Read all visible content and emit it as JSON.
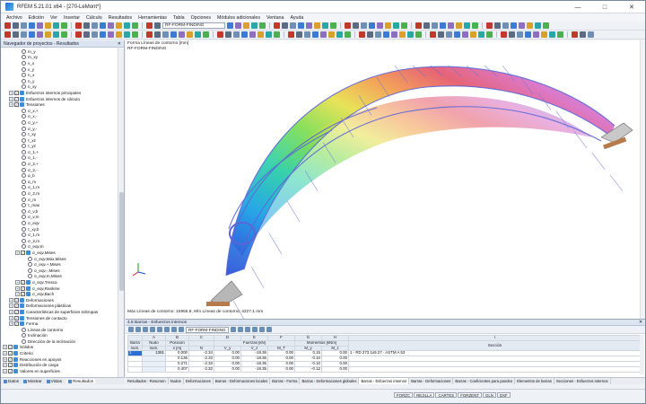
{
  "window": {
    "title": "RFEM 5.21.01 x64 - [270-LeMont*]",
    "controls": [
      "—",
      "□",
      "✕"
    ]
  },
  "menu": [
    "Archivo",
    "Edición",
    "Ver",
    "Insertar",
    "Cálculo",
    "Resultados",
    "Herramientas",
    "Tabla",
    "Opciones",
    "Módulos adicionales",
    "Ventana",
    "Ayuda"
  ],
  "toolbar": {
    "loadcase_combo": "RF-FORM-FINDING"
  },
  "navigator": {
    "title": "Navegador de proyectos - Resultados",
    "items": [
      {
        "level": 3,
        "type": "radio",
        "label": "m_y"
      },
      {
        "level": 3,
        "type": "radio",
        "label": "m_xy"
      },
      {
        "level": 3,
        "type": "radio",
        "label": "v_x"
      },
      {
        "level": 3,
        "type": "radio",
        "label": "v_y"
      },
      {
        "level": 3,
        "type": "radio",
        "label": "n_x"
      },
      {
        "level": 3,
        "type": "radio",
        "label": "n_y"
      },
      {
        "level": 3,
        "type": "radio",
        "label": "n_xy"
      },
      {
        "level": 1,
        "type": "check",
        "label": "Esfuerzos internos principales"
      },
      {
        "level": 1,
        "type": "check",
        "label": "Esfuerzos internos de cálculo"
      },
      {
        "level": 1,
        "type": "check",
        "label": "Tensiones"
      },
      {
        "level": 3,
        "type": "radio",
        "label": "σ_x,+"
      },
      {
        "level": 3,
        "type": "radio",
        "label": "σ_x,-"
      },
      {
        "level": 3,
        "type": "radio",
        "label": "σ_y,+"
      },
      {
        "level": 3,
        "type": "radio",
        "label": "σ_y,-"
      },
      {
        "level": 3,
        "type": "radio",
        "label": "τ_xy"
      },
      {
        "level": 3,
        "type": "radio",
        "label": "τ_xz"
      },
      {
        "level": 3,
        "type": "radio",
        "label": "τ_yz"
      },
      {
        "level": 3,
        "type": "radio",
        "label": "σ_1,+"
      },
      {
        "level": 3,
        "type": "radio",
        "label": "σ_1,-"
      },
      {
        "level": 3,
        "type": "radio",
        "label": "σ_2,+"
      },
      {
        "level": 3,
        "type": "radio",
        "label": "σ_2,-"
      },
      {
        "level": 3,
        "type": "radio",
        "label": "α_b"
      },
      {
        "level": 3,
        "type": "radio",
        "label": "α_m"
      },
      {
        "level": 3,
        "type": "radio",
        "label": "σ_1,m"
      },
      {
        "level": 3,
        "type": "radio",
        "label": "σ_2,m"
      },
      {
        "level": 3,
        "type": "radio",
        "label": "σ_m"
      },
      {
        "level": 3,
        "type": "radio",
        "label": "τ_max"
      },
      {
        "level": 3,
        "type": "radio",
        "label": "σ_v,b"
      },
      {
        "level": 3,
        "type": "radio",
        "label": "σ_v,m"
      },
      {
        "level": 3,
        "type": "radio",
        "label": "σ_eqv"
      },
      {
        "level": 3,
        "type": "radio",
        "label": "τ_xy,b"
      },
      {
        "level": 3,
        "type": "radio",
        "label": "σ_1,m"
      },
      {
        "level": 3,
        "type": "radio",
        "label": "σ_2,m"
      },
      {
        "level": 3,
        "type": "radio",
        "label": "σ_eqv,m"
      },
      {
        "level": 2,
        "type": "check",
        "label": "σ_eqv,Mises"
      },
      {
        "level": 4,
        "type": "radio",
        "label": "σ_eqv,Max,Mises"
      },
      {
        "level": 4,
        "type": "radio",
        "label": "σ_eqv,+,Mises"
      },
      {
        "level": 4,
        "type": "radio",
        "label": "σ_eqv,-,Mises"
      },
      {
        "level": 4,
        "type": "radio",
        "label": "σ_eqv,m,Mises"
      },
      {
        "level": 2,
        "type": "check",
        "label": "σ_eqv,Tresca"
      },
      {
        "level": 2,
        "type": "check",
        "label": "σ_eqv,Rankine"
      },
      {
        "level": 2,
        "type": "check",
        "label": "σ_eqv,Bach"
      },
      {
        "level": 1,
        "type": "check",
        "label": "Deformaciones"
      },
      {
        "level": 1,
        "type": "check",
        "label": "Deformaciones plásticas"
      },
      {
        "level": 1,
        "type": "check",
        "label": "Características de superficies isótropas"
      },
      {
        "level": 1,
        "type": "check",
        "label": "Tensiones de contacto"
      },
      {
        "level": 1,
        "type": "check",
        "label": "Forma"
      },
      {
        "level": 3,
        "type": "radio",
        "label": "Líneas de contorno"
      },
      {
        "level": 3,
        "type": "radio",
        "label": "Inclinación"
      },
      {
        "level": 3,
        "type": "radio",
        "label": "Dirección de la inclinación"
      },
      {
        "level": 0,
        "type": "check",
        "label": "Sólidos"
      },
      {
        "level": 0,
        "type": "check",
        "label": "Criterio"
      },
      {
        "level": 0,
        "type": "check",
        "label": "Reacciones en apoyos"
      },
      {
        "level": 0,
        "type": "check",
        "label": "Distribución de carga"
      },
      {
        "level": 0,
        "type": "check",
        "label": "Valores en superficies"
      }
    ],
    "tabs": [
      "Datos",
      "Mostrar",
      "Vistas",
      "Resultados"
    ]
  },
  "viewport": {
    "title_line1": "Forma Líneas de contorno [mm]",
    "title_line2": "RF-FORM-FINDING",
    "footer": "Máx Líneas de contorno: 15955.8, Mín Líneas de contorno: 4227.1 mm"
  },
  "results": {
    "panel_title": "4.6 Barras - Esfuerzos internos",
    "combo": "RF-FORM-FINDING",
    "col_letters": [
      "A",
      "B",
      "C",
      "D",
      "E",
      "F",
      "G",
      "H",
      "I"
    ],
    "head1": [
      "Barra",
      "Nudo",
      "Posición",
      "",
      "Fuerzas [kN]",
      "",
      "",
      "Momentos [kNm]",
      "",
      "Sección"
    ],
    "head2": [
      "núm.",
      "núm.",
      "x [m]",
      "N",
      "V_y",
      "V_z",
      "M_T",
      "M_y",
      "M_z",
      ""
    ],
    "rows": [
      [
        "1",
        "1381",
        "0.000",
        "-2.34",
        "0.00",
        "-18.36",
        "0.00",
        "0.15",
        "0.00",
        "1 - RD 273.1x9.27 · ASTM A 53"
      ],
      [
        "",
        "",
        "0.136",
        "-2.33",
        "0.00",
        "-18.36",
        "0.00",
        "-0.10",
        "0.00",
        ""
      ],
      [
        "",
        "",
        "0.271",
        "-2.33",
        "0.00",
        "-18.35",
        "0.00",
        "-0.10",
        "0.00",
        ""
      ],
      [
        "",
        "",
        "0.407",
        "-2.32",
        "0.00",
        "-18.35",
        "0.00",
        "-0.12",
        "0.00",
        ""
      ]
    ]
  },
  "sheet_tabs": [
    "Resultados - Resumen",
    "Nudos",
    "Deformaciones",
    "Barras - Deformaciones locales",
    "Barras - Forma",
    "Barras - Deformaciones globales",
    "Barras - Esfuerzos internos",
    "Barras - Deformaciones",
    "Barras - Coeficientes para pandeo",
    "Elementos de barras",
    "Secciones - Esfuerzos internos"
  ],
  "status_buttons": [
    "FORZC",
    "REJILLA",
    "CARTES",
    "FORZENT",
    "GLN",
    "DXF"
  ],
  "colors": {
    "accent": "#2d6fcf",
    "panel_header": "#dbe4f0"
  }
}
